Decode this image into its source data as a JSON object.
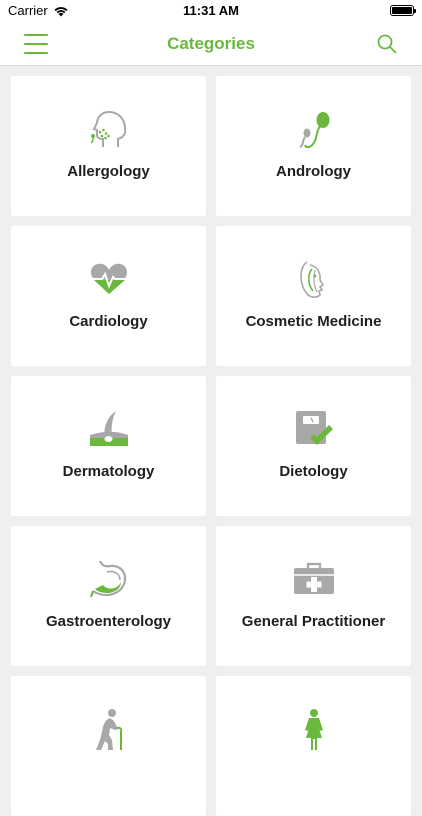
{
  "status_bar": {
    "carrier": "Carrier",
    "time": "11:31 AM"
  },
  "nav": {
    "title": "Categories",
    "menu_icon": "hamburger-menu-icon",
    "search_icon": "search-icon"
  },
  "colors": {
    "accent": "#6ab83e",
    "icon_gray": "#a8a8a8",
    "background": "#efeff1"
  },
  "categories": [
    {
      "label": "Allergology",
      "icon": "allergy-head-icon"
    },
    {
      "label": "Andrology",
      "icon": "sperm-icon"
    },
    {
      "label": "Cardiology",
      "icon": "heart-pulse-icon"
    },
    {
      "label": "Cosmetic Medicine",
      "icon": "face-profile-icon"
    },
    {
      "label": "Dermatology",
      "icon": "skin-hair-icon"
    },
    {
      "label": "Dietology",
      "icon": "scale-check-icon"
    },
    {
      "label": "Gastroenterology",
      "icon": "stomach-icon"
    },
    {
      "label": "General Practitioner",
      "icon": "medical-kit-icon"
    },
    {
      "label": "",
      "icon": "elderly-person-icon"
    },
    {
      "label": "",
      "icon": "woman-figure-icon"
    }
  ]
}
